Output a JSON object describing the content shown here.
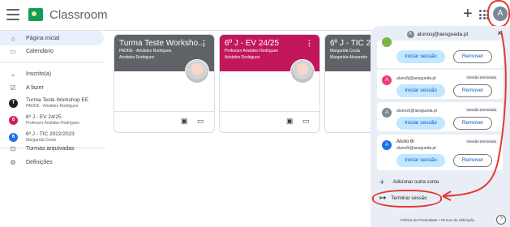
{
  "app": {
    "title": "Classroom",
    "menu_icon": "menu-icon",
    "logo_icon": "classroom-logo-icon",
    "plus_label": "+",
    "avatar_initial": "A",
    "colors": {
      "brand": "#0f9d58",
      "accent": "#0b57d0",
      "annotation": "#e53935"
    }
  },
  "sidebar": {
    "items": [
      {
        "label": "Página inicial",
        "icon": "home-icon",
        "active": true
      },
      {
        "label": "Calendário",
        "icon": "calendar-icon",
        "active": false
      }
    ],
    "enrolled": {
      "label": "Inscrito(a)",
      "icon": "enrolled-icon"
    },
    "todo": {
      "label": "A fazer",
      "icon": "todo-icon"
    },
    "classes": [
      {
        "initial": "T",
        "color": "#202124",
        "name": "Turma Teste Workshop EE",
        "sub": "PADDE - Aristides Rodrigues"
      },
      {
        "initial": "6",
        "color": "#d81b60",
        "name": "6º J - EV 24/25",
        "sub": "Professor Aristides Rodrigues"
      },
      {
        "initial": "6",
        "color": "#1a73e8",
        "name": "6º J - TIC 2022/2023",
        "sub": "Margarida Costa"
      }
    ],
    "archived": {
      "label": "Turmas arquivadas",
      "icon": "archive-icon"
    },
    "settings": {
      "label": "Definições",
      "icon": "settings-icon"
    }
  },
  "cards": [
    {
      "title": "Turma Teste Worksho...",
      "sub1": "PADDE - Aristides Rodrigues",
      "sub2": "Aristides Rodrigues",
      "color": "#5f6368"
    },
    {
      "title": "6º J - EV 24/25",
      "sub1": "Professor Aristides Rodrigues",
      "sub2": "Aristides Rodrigues",
      "color": "#c2185b"
    },
    {
      "title": "6º J - TIC 20",
      "sub1": "Margarida Costa",
      "sub2": "Margarida Alexandre",
      "color": "#5f6368"
    }
  ],
  "card_more_label": "⋮",
  "popup": {
    "email": "alunosj@aesgueda.pt",
    "close_label": "×",
    "accounts": [
      {
        "initial": "",
        "color": "#7cb342",
        "name": "",
        "email": "",
        "status": "",
        "login": "Iniciar sessão",
        "remove": "Remover"
      },
      {
        "initial": "A",
        "color": "#ec407a",
        "name": "",
        "email": "aluno6j@aesgueda.pt",
        "status": "Sessão terminada",
        "login": "Iniciar sessão",
        "remove": "Remover"
      },
      {
        "initial": "A",
        "color": "#7b8a95",
        "name": "",
        "email": "alunosh@aesgueda.pt",
        "status": "Sessão terminada",
        "login": "Iniciar sessão",
        "remove": "Remover"
      },
      {
        "initial": "A",
        "color": "#1a73e8",
        "name": "Aluno 6i",
        "email": "aluno6i@aesgueda.pt",
        "status": "Sessão terminada",
        "login": "Iniciar sessão",
        "remove": "Remover"
      }
    ],
    "add_account": "Adicionar outra conta",
    "logout": "Terminar sessão",
    "footer": "Política de Privacidade  •  Termos de Utilização"
  },
  "help_label": "?"
}
